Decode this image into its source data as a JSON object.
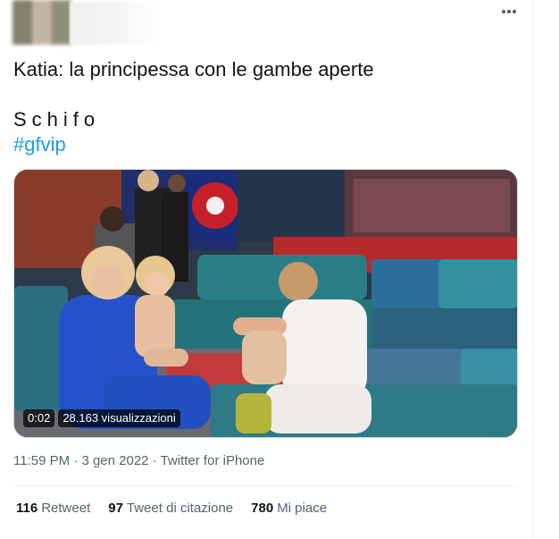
{
  "tweet": {
    "line1": "Katia: la principessa con le gambe aperte",
    "line2": "Schifo",
    "hashtag": "#gfvip"
  },
  "video": {
    "duration": "0:02",
    "views": "28.163 visualizzazioni"
  },
  "meta": {
    "time": "11:59 PM",
    "sep1": "·",
    "date": "3 gen 2022",
    "sep2": "·",
    "source": "Twitter for iPhone"
  },
  "stats": {
    "retweets_count": "116",
    "retweets_label": "Retweet",
    "quotes_count": "97",
    "quotes_label": "Tweet di citazione",
    "likes_count": "780",
    "likes_label": "Mi piace"
  },
  "icons": {
    "more": "more-horizontal-icon"
  },
  "colors": {
    "link": "#1d9bf0",
    "secondary_text": "#536471",
    "primary_text": "#0f1419",
    "border": "#eff3f4"
  }
}
